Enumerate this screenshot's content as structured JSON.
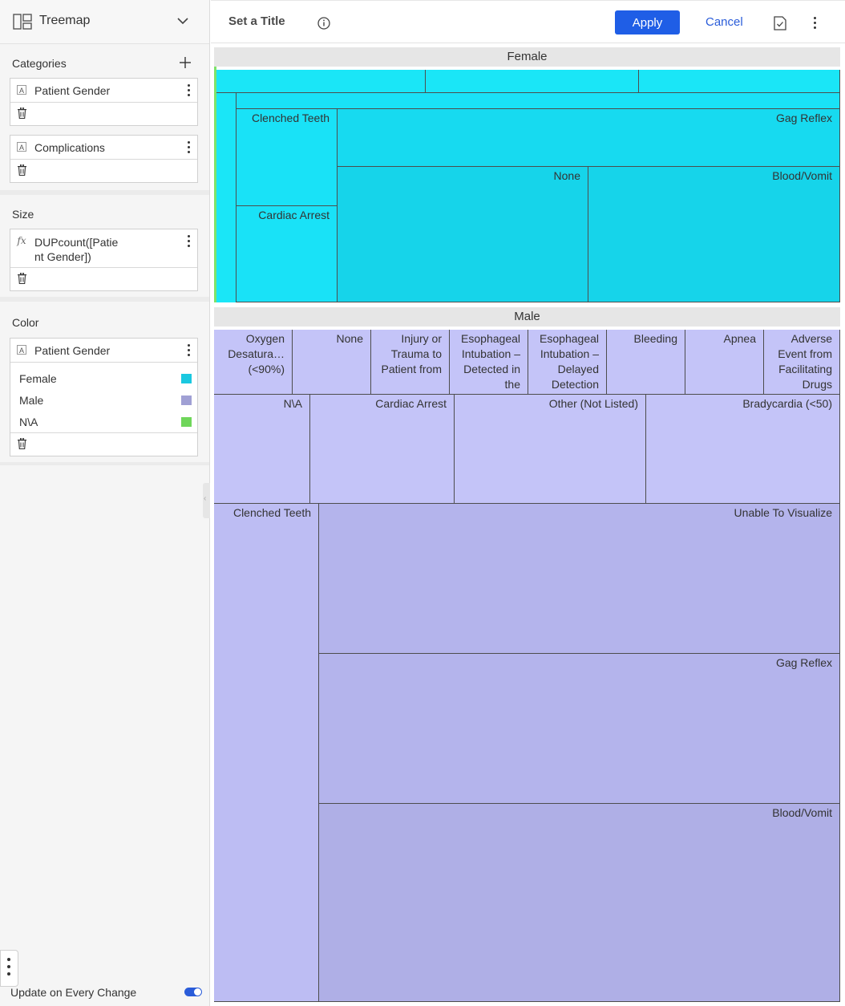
{
  "sidebar": {
    "chart_type": "Treemap",
    "categories_label": "Categories",
    "category_fields": [
      "Patient Gender",
      "Complications"
    ],
    "size_label": "Size",
    "size_field": "DUPcount([Patie nt Gender])",
    "size_field_line1": "DUPcount([Patie",
    "size_field_line2": "nt Gender])",
    "color_label": "Color",
    "color_field": "Patient Gender",
    "legend": [
      {
        "label": "Female",
        "color": "#1ac8e0"
      },
      {
        "label": "Male",
        "color": "#a0a0d4"
      },
      {
        "label": "N\\A",
        "color": "#6fd65a"
      }
    ],
    "update_label": "Update on Every Change"
  },
  "toolbar": {
    "title_placeholder": "Set a Title",
    "apply_label": "Apply",
    "cancel_label": "Cancel"
  },
  "chart_data": {
    "type": "treemap",
    "groups": [
      {
        "name": "Female",
        "color": "#1ae6f7",
        "tiles": [
          "",
          "",
          "",
          "",
          "Clenched Teeth",
          "Gag Reflex",
          "None",
          "Blood/Vomit",
          "Cardiac Arrest"
        ]
      },
      {
        "name": "Male",
        "color": "#c4c4f8",
        "tiles": [
          "Oxygen Desatura… (<90%)",
          "None",
          "Injury or Trauma to Patient from",
          "Esophageal Intubation – Detected in the",
          "Esophageal Intubation – Delayed Detection",
          "Bleeding",
          "Apnea",
          "Adverse Event from Facilitating Drugs",
          "N\\A",
          "Cardiac Arrest",
          "Other (Not Listed)",
          "Bradycardia (<50)",
          "Clenched Teeth",
          "Unable To Visualize",
          "Gag Reflex",
          "Blood/Vomit"
        ]
      }
    ]
  }
}
